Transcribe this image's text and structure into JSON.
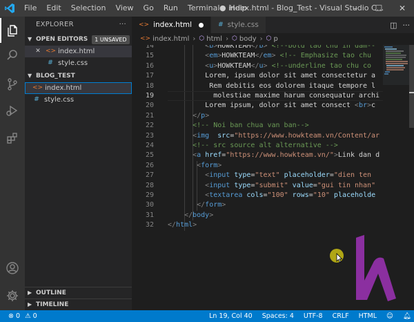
{
  "titlebar": {
    "menu": [
      "File",
      "Edit",
      "Selection",
      "View",
      "Go",
      "Run",
      "Terminal",
      "Help"
    ],
    "title": "● index.html - Blog_Test - Visual Studio C...",
    "minimize": "–",
    "maximize": "☐",
    "close": "✕"
  },
  "activity": [
    "explorer-icon",
    "search-icon",
    "source-control-icon",
    "run-debug-icon",
    "extensions-icon",
    "account-icon",
    "manage-gear-icon"
  ],
  "sidebar": {
    "title": "EXPLORER",
    "more": "···",
    "open_editors": {
      "label": "OPEN EDITORS",
      "badge": "1 UNSAVED",
      "items": [
        {
          "name": "index.html",
          "icon": "html-icon",
          "selected": true,
          "modified": true
        },
        {
          "name": "style.css",
          "icon": "css-icon",
          "selected": false,
          "modified": false
        }
      ]
    },
    "folder": {
      "label": "BLOG_TEST",
      "items": [
        {
          "name": "index.html",
          "icon": "html-icon",
          "selected": true
        },
        {
          "name": "style.css",
          "icon": "css-icon",
          "selected": false
        }
      ]
    },
    "outline": "OUTLINE",
    "timeline": "TIMELINE"
  },
  "tabs": [
    {
      "label": "index.html",
      "icon": "html-icon",
      "active": true,
      "dirty": true
    },
    {
      "label": "style.css",
      "icon": "css-icon",
      "active": false,
      "dirty": false
    }
  ],
  "breadcrumbs": {
    "file": "index.html",
    "path": [
      "html",
      "body",
      "p"
    ]
  },
  "code": {
    "current_line": 19,
    "lines": [
      {
        "n": 14,
        "indent": 9,
        "tokens": [
          [
            "br",
            "<"
          ],
          [
            "tag",
            "b"
          ],
          [
            "br",
            ">"
          ],
          [
            "txt",
            "HOWKTEAM"
          ],
          [
            "br",
            "</"
          ],
          [
            "tag",
            "b"
          ],
          [
            "br",
            "> "
          ],
          [
            "cmt",
            "<!--bold tao chu in dam--"
          ]
        ]
      },
      {
        "n": 15,
        "indent": 9,
        "tokens": [
          [
            "br",
            "<"
          ],
          [
            "tag",
            "em"
          ],
          [
            "br",
            ">"
          ],
          [
            "txt",
            "HOWKTEAM"
          ],
          [
            "br",
            "</"
          ],
          [
            "tag",
            "em"
          ],
          [
            "br",
            "> "
          ],
          [
            "cmt",
            "<!-- Emphasize tao chu"
          ]
        ]
      },
      {
        "n": 16,
        "indent": 9,
        "tokens": [
          [
            "br",
            "<"
          ],
          [
            "tag",
            "u"
          ],
          [
            "br",
            ">"
          ],
          [
            "txt",
            "HOWKTEAM"
          ],
          [
            "br",
            "</"
          ],
          [
            "tag",
            "u"
          ],
          [
            "br",
            "> "
          ],
          [
            "cmt",
            "<!--underline tao chu co"
          ]
        ]
      },
      {
        "n": 17,
        "indent": 9,
        "tokens": [
          [
            "txt",
            "Lorem, ipsum dolor sit amet consectetur a"
          ]
        ]
      },
      {
        "n": 18,
        "indent": 10,
        "tokens": [
          [
            "txt",
            "Rem debitis eos dolorem itaque tempore l"
          ]
        ]
      },
      {
        "n": 19,
        "indent": 11,
        "tokens": [
          [
            "txt",
            "molestiae maxime harum consequatur archi"
          ]
        ]
      },
      {
        "n": 20,
        "indent": 9,
        "tokens": [
          [
            "txt",
            "Lorem ipsum, dolor sit amet consect "
          ],
          [
            "br",
            "<"
          ],
          [
            "tag",
            "br"
          ],
          [
            "br",
            ">"
          ],
          [
            "txt",
            "c"
          ]
        ]
      },
      {
        "n": 21,
        "indent": 6,
        "tokens": [
          [
            "br",
            "</"
          ],
          [
            "tag",
            "p"
          ],
          [
            "br",
            ">"
          ]
        ]
      },
      {
        "n": 22,
        "indent": 6,
        "tokens": [
          [
            "cmt",
            "<!-- Noi ban chua van ban-->"
          ]
        ]
      },
      {
        "n": 23,
        "indent": 6,
        "tokens": [
          [
            "br",
            "<"
          ],
          [
            "tag",
            "img"
          ],
          [
            "txt",
            "  "
          ],
          [
            "attr",
            "src"
          ],
          [
            "txt",
            "="
          ],
          [
            "str",
            "\"https://www.howkteam.vn/Content/ar"
          ]
        ]
      },
      {
        "n": 24,
        "indent": 6,
        "tokens": [
          [
            "cmt",
            "<!-- src source alt alternative -->"
          ]
        ]
      },
      {
        "n": 25,
        "indent": 6,
        "tokens": [
          [
            "br",
            "<"
          ],
          [
            "tag",
            "a"
          ],
          [
            "txt",
            " "
          ],
          [
            "attr",
            "href"
          ],
          [
            "txt",
            "="
          ],
          [
            "str",
            "\"https://www.howkteam.vn/\""
          ],
          [
            "br",
            ">"
          ],
          [
            "txt",
            "Link dan d"
          ]
        ]
      },
      {
        "n": 26,
        "indent": 7,
        "tokens": [
          [
            "br",
            "<"
          ],
          [
            "tag",
            "form"
          ],
          [
            "br",
            ">"
          ]
        ]
      },
      {
        "n": 27,
        "indent": 9,
        "tokens": [
          [
            "br",
            "<"
          ],
          [
            "tag",
            "input"
          ],
          [
            "txt",
            " "
          ],
          [
            "attr",
            "type"
          ],
          [
            "txt",
            "="
          ],
          [
            "str",
            "\"text\""
          ],
          [
            "txt",
            " "
          ],
          [
            "attr",
            "placeholder"
          ],
          [
            "txt",
            "="
          ],
          [
            "str",
            "\"dien ten"
          ]
        ]
      },
      {
        "n": 28,
        "indent": 9,
        "tokens": [
          [
            "br",
            "<"
          ],
          [
            "tag",
            "input"
          ],
          [
            "txt",
            " "
          ],
          [
            "attr",
            "type"
          ],
          [
            "txt",
            "="
          ],
          [
            "str",
            "\"submit\""
          ],
          [
            "txt",
            " "
          ],
          [
            "attr",
            "value"
          ],
          [
            "txt",
            "="
          ],
          [
            "str",
            "\"gui tin nhan\""
          ]
        ]
      },
      {
        "n": 29,
        "indent": 9,
        "tokens": [
          [
            "br",
            "<"
          ],
          [
            "tag",
            "textarea"
          ],
          [
            "txt",
            " "
          ],
          [
            "attr",
            "cols"
          ],
          [
            "txt",
            "="
          ],
          [
            "str",
            "\"100\""
          ],
          [
            "txt",
            " "
          ],
          [
            "attr",
            "rows"
          ],
          [
            "txt",
            "="
          ],
          [
            "str",
            "\"10\""
          ],
          [
            "txt",
            " "
          ],
          [
            "attr",
            "placeholde"
          ]
        ]
      },
      {
        "n": 30,
        "indent": 7,
        "tokens": [
          [
            "br",
            "</"
          ],
          [
            "tag",
            "form"
          ],
          [
            "br",
            ">"
          ]
        ]
      },
      {
        "n": 31,
        "indent": 4,
        "tokens": [
          [
            "br",
            "</"
          ],
          [
            "tag",
            "body"
          ],
          [
            "br",
            ">"
          ]
        ]
      },
      {
        "n": 32,
        "indent": 0,
        "tokens": [
          [
            "br",
            "</"
          ],
          [
            "tag",
            "html"
          ],
          [
            "br",
            ">"
          ]
        ]
      }
    ]
  },
  "statusbar": {
    "errors": "0",
    "warnings": "0",
    "position": "Ln 19, Col 40",
    "spaces": "Spaces: 4",
    "encoding": "UTF-8",
    "eol": "CRLF",
    "language": "HTML"
  },
  "colors": {
    "accent": "#007acc",
    "logo": "#8b2fa0",
    "cursor_highlight": "#cabe14"
  }
}
